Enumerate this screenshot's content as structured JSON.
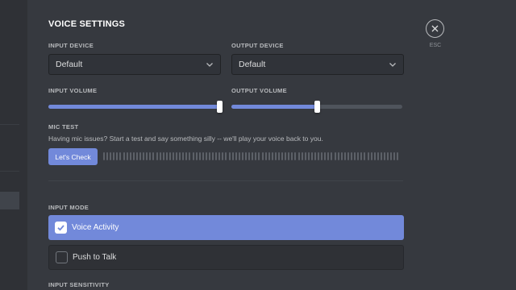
{
  "page": {
    "title": "VOICE SETTINGS"
  },
  "input_device": {
    "label": "INPUT DEVICE",
    "value": "Default"
  },
  "output_device": {
    "label": "OUTPUT DEVICE",
    "value": "Default"
  },
  "input_volume": {
    "label": "INPUT VOLUME",
    "level": 1.0
  },
  "output_volume": {
    "label": "OUTPUT VOLUME",
    "level": 0.5
  },
  "mic_test": {
    "label": "MIC TEST",
    "description": "Having mic issues? Start a test and say something silly -- we'll play your voice back to you.",
    "button_label": "Let's Check"
  },
  "input_mode": {
    "label": "INPUT MODE",
    "options": [
      {
        "label": "Voice Activity",
        "selected": true
      },
      {
        "label": "Push to Talk",
        "selected": false
      }
    ]
  },
  "input_sensitivity": {
    "label": "INPUT SENSITIVITY"
  },
  "close": {
    "label": "ESC"
  },
  "colors": {
    "accent": "#7289da",
    "background": "#36393f",
    "sidebar": "#2f3136"
  }
}
